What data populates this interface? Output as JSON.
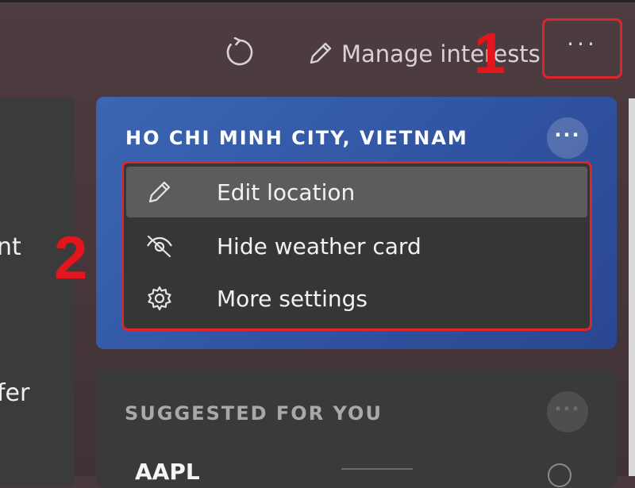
{
  "toolbar": {
    "refresh_icon": "refresh-icon",
    "manage_icon": "pencil-icon",
    "manage_label": "Manage interests",
    "more_icon": "more-horizontal-icon",
    "more_label": "···"
  },
  "annotations": {
    "step1": "1",
    "step2": "2",
    "highlight_color": "#e0242c"
  },
  "left_panel": {
    "text1": "nt",
    "text2": "fer"
  },
  "weather_card": {
    "title": "HO CHI MINH CITY, VIETNAM",
    "more_label": "···",
    "accent": "#3257a5",
    "menu": [
      {
        "icon": "pencil-icon",
        "label": "Edit location",
        "highlighted": true
      },
      {
        "icon": "eye-off-icon",
        "label": "Hide weather card",
        "highlighted": false
      },
      {
        "icon": "gear-icon",
        "label": "More settings",
        "highlighted": false
      }
    ]
  },
  "suggested_card": {
    "title": "SUGGESTED FOR YOU",
    "more_label": "···",
    "stock_symbol": "AAPL"
  }
}
